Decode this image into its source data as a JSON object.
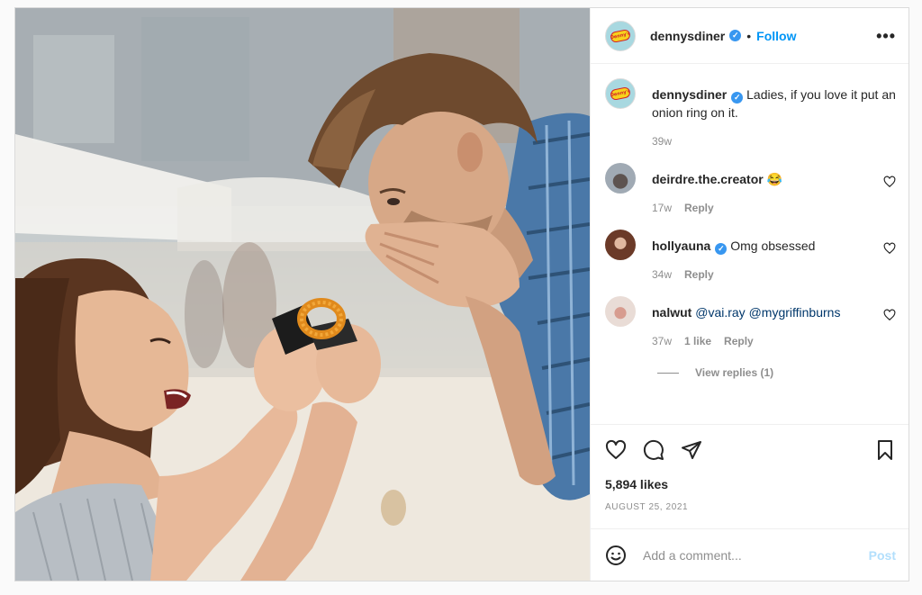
{
  "post": {
    "account": {
      "username": "dennysdiner",
      "verified": true,
      "follow_label": "Follow",
      "separator": "•",
      "more_label": "•••",
      "avatar_logo_text": "Denny's"
    },
    "caption": {
      "username": "dennysdiner",
      "text": "Ladies, if you love it put an onion ring on it.",
      "age": "39w"
    },
    "comments": [
      {
        "username": "deirdre.the.creator",
        "verified": false,
        "text": "😂",
        "age": "17w",
        "likes": "",
        "reply_label": "Reply",
        "avatar_color": "#8a95a0"
      },
      {
        "username": "hollyauna",
        "verified": true,
        "text": "Omg obsessed",
        "age": "34w",
        "likes": "",
        "reply_label": "Reply",
        "avatar_color": "#6b4a3a"
      },
      {
        "username": "nalwut",
        "verified": false,
        "mentions": [
          "@vai.ray",
          "@mygriffinburns"
        ],
        "age": "37w",
        "likes": "1 like",
        "reply_label": "Reply",
        "avatar_color": "#c9a7a3"
      }
    ],
    "view_replies_label": "View replies (1)",
    "likes_label": "5,894 likes",
    "date_label": "AUGUST 25, 2021",
    "comment_input": {
      "placeholder": "Add a comment...",
      "value": ""
    },
    "post_button_label": "Post",
    "icons": {
      "like": "heart-icon",
      "comment": "comment-bubble-icon",
      "share": "paper-plane-icon",
      "save": "bookmark-icon",
      "emoji": "smiley-icon",
      "more": "more-options-icon",
      "comment_like": "heart-icon"
    },
    "colors": {
      "follow_blue": "#0095f6",
      "verified_blue": "#3897f0",
      "mention_blue": "#00376b",
      "post_disabled": "#b2dffc",
      "muted": "#8e8e8e"
    }
  }
}
